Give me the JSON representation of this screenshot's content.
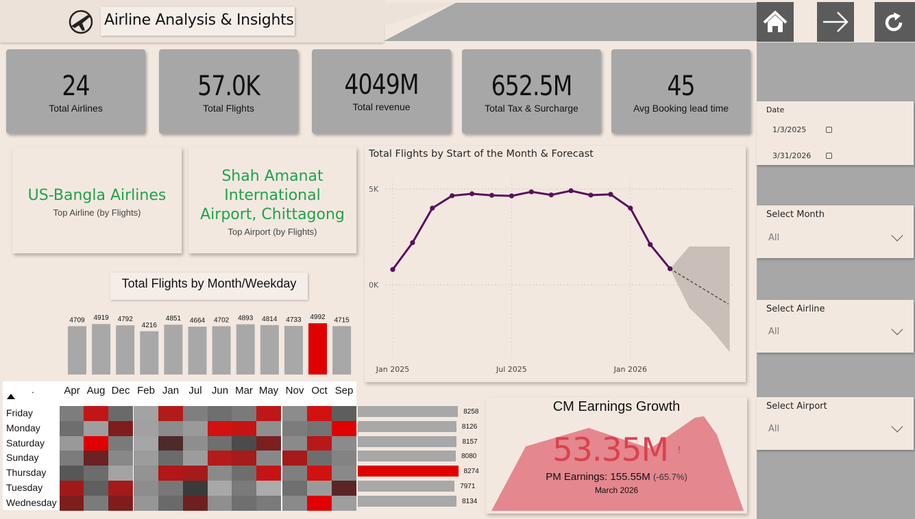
{
  "header": {
    "title": "Airline Analysis & Insights",
    "logo_icon": "airplane-icon",
    "nav": [
      {
        "name": "home-button",
        "icon": "home-icon"
      },
      {
        "name": "next-page-button",
        "icon": "arrow-right-icon"
      },
      {
        "name": "reset-button",
        "icon": "refresh-icon"
      }
    ]
  },
  "kpis": [
    {
      "value": "24",
      "label": "Total Airlines"
    },
    {
      "value": "57.0K",
      "label": "Total Flights"
    },
    {
      "value": "4049M",
      "label": "Total revenue"
    },
    {
      "value": "652.5M",
      "label": "Total Tax & Surcharge"
    },
    {
      "value": "45",
      "label": "Avg Booking lead time"
    }
  ],
  "top_cards": [
    {
      "name": "US-Bangla Airlines",
      "label": "Top Airline (by Flights)"
    },
    {
      "name": "Shah Amanat International Airport, Chittagong",
      "label": "Top Airport (by Flights)"
    }
  ],
  "filters": {
    "date": {
      "title": "Date",
      "from": "1/3/2025",
      "to": "3/31/2026"
    },
    "month": {
      "title": "Select Month",
      "value": "All"
    },
    "airline": {
      "title": "Select Airline",
      "value": "All"
    },
    "airport": {
      "title": "Select Airport",
      "value": "All"
    }
  },
  "month_weekday_title": "Total Flights by Month/Weekday",
  "month_bars": {
    "values": [
      4709,
      4919,
      4792,
      4216,
      4851,
      4664,
      4702,
      4893,
      4814,
      4733,
      4992,
      4715
    ],
    "highlight_index": 10,
    "color": "#a8a8a8",
    "highlight_color": "#e00000"
  },
  "heatmap": {
    "corner": ".",
    "months": [
      "Apr",
      "Aug",
      "Dec",
      "Feb",
      "Jan",
      "Jul",
      "Jun",
      "Mar",
      "May",
      "Nov",
      "Oct",
      "Sep"
    ],
    "days": [
      "Friday",
      "Monday",
      "Saturday",
      "Sunday",
      "Thursday",
      "Tuesday",
      "Wednesday"
    ],
    "colors": [
      [
        "#7d7d7d",
        "#c01616",
        "#6a6a6a",
        "#a3a3a3",
        "#b31a1a",
        "#7f7f7f",
        "#6f6f6f",
        "#7a7a7a",
        "#be1717",
        "#8c8c8c",
        "#d21111",
        "#5e5e5e"
      ],
      [
        "#6e6e6e",
        "#9e9e9e",
        "#7f1c1c",
        "#a1a1a1",
        "#8c8c8c",
        "#9a9a9a",
        "#d21111",
        "#c51414",
        "#8f8f8f",
        "#7c7c7c",
        "#747474",
        "#e00000"
      ],
      [
        "#999999",
        "#e00000",
        "#7a7a7a",
        "#a6a6a6",
        "#4f2a2a",
        "#8e8e8e",
        "#6f6f6f",
        "#4b4b4b",
        "#7a2020",
        "#8a8a8a",
        "#b81818",
        "#8b8b8b"
      ],
      [
        "#7c7c7c",
        "#6a2222",
        "#888888",
        "#9c9c9c",
        "#6b6b6b",
        "#9c9c9c",
        "#b41b1b",
        "#a61b1b",
        "#888888",
        "#a61a1a",
        "#6e6e6e",
        "#838383"
      ],
      [
        "#575757",
        "#6c6c6c",
        "#a3a3a3",
        "#939393",
        "#b21616",
        "#a51a1a",
        "#8a8a8a",
        "#6e6e6e",
        "#c51414",
        "#7f7f7f",
        "#d21111",
        "#898989"
      ],
      [
        "#a01919",
        "#5f5f5f",
        "#a51a1a",
        "#8d8d8d",
        "#777777",
        "#3a3a3a",
        "#a8a8a8",
        "#7a7a7a",
        "#ababab",
        "#6f6f6f",
        "#9a9a9a",
        "#5c2525"
      ],
      [
        "#7f1d1d",
        "#7b7b7b",
        "#801c1c",
        "#969696",
        "#6a6a6a",
        "#6d2020",
        "#8f8f8f",
        "#6f6f6f",
        "#7a7a7a",
        "#8a8a8a",
        "#e00000",
        "#9e9e9e"
      ]
    ]
  },
  "weekday_bars": {
    "values": [
      8258,
      8126,
      8157,
      8080,
      8274,
      7971,
      8134
    ],
    "highlight_index": 4,
    "color": "#a8a8a8",
    "highlight_color": "#e00000"
  },
  "chart_data": {
    "type": "line",
    "title": "Total Flights by Start of the Month & Forecast",
    "x_tick_labels": [
      "Jan 2025",
      "Jul 2025",
      "Jan 2026"
    ],
    "y_tick_labels": [
      "5K",
      "0K"
    ],
    "ylim": [
      0,
      5000
    ],
    "grid": true,
    "series": [
      {
        "values": [
          800,
          2200,
          4000,
          4650,
          4750,
          4670,
          4640,
          4850,
          4690,
          4910,
          4680,
          4720,
          4000,
          2100,
          840
        ],
        "color": "#5a0f5a"
      }
    ],
    "forecast": {
      "color": "#c9bfb8",
      "line_color": "#333333"
    }
  },
  "earnings": {
    "title": "CM Earnings Growth",
    "value": "53.35M",
    "badge": "!",
    "pm_text": "PM Earnings: 155.55M",
    "pm_change": "(-65.7%)",
    "period": "March 2026",
    "value_color": "#d9424e",
    "area_color": "#e4878e"
  }
}
